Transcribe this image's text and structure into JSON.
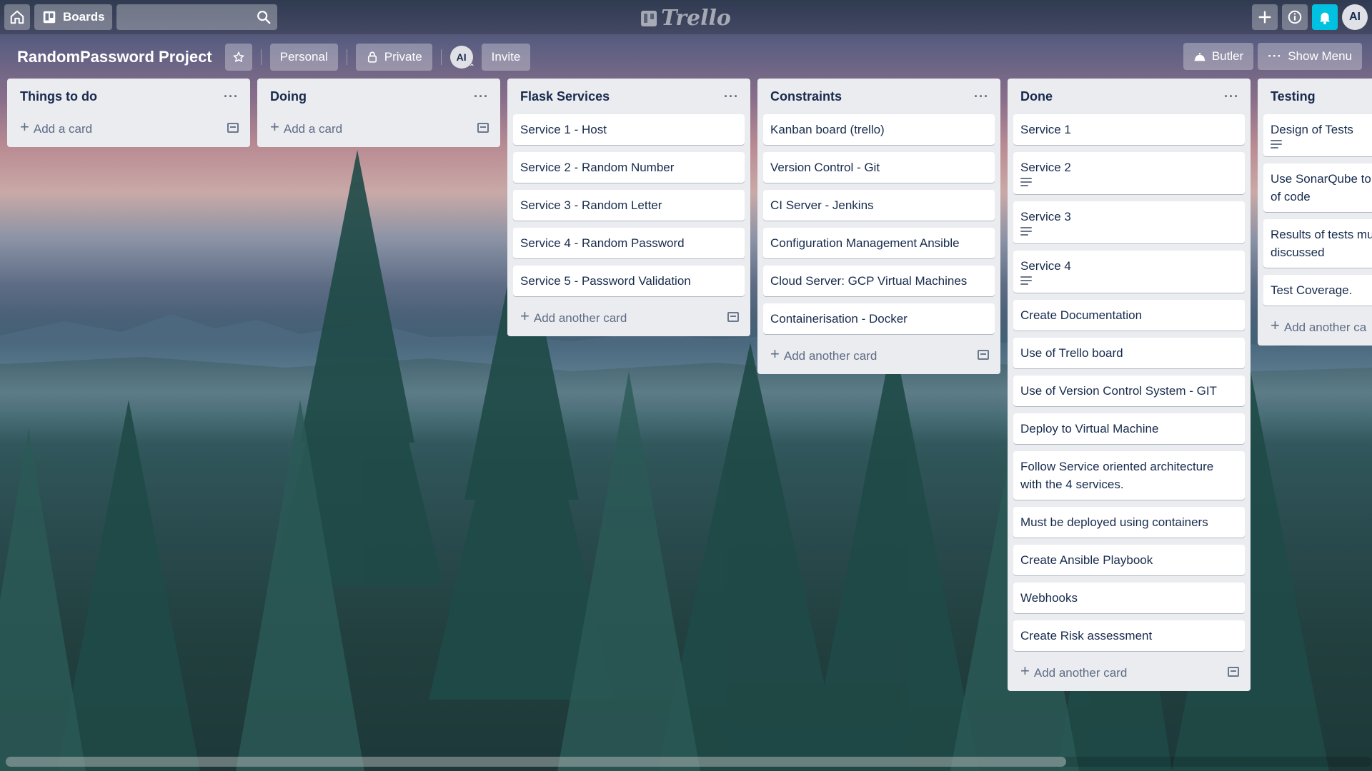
{
  "header": {
    "boards_label": "Boards",
    "search": {
      "placeholder": "",
      "value": ""
    },
    "logo_text": "Trello",
    "avatar_initials": "AI"
  },
  "board": {
    "title": "RandomPassword Project",
    "team_label": "Personal",
    "visibility_label": "Private",
    "member_initials": "AI",
    "invite_label": "Invite",
    "butler_label": "Butler",
    "show_menu_label": "Show Menu"
  },
  "lists": [
    {
      "title": "Things to do",
      "cards": [],
      "add_label": "Add a card"
    },
    {
      "title": "Doing",
      "cards": [],
      "add_label": "Add a card"
    },
    {
      "title": "Flask Services",
      "cards": [
        {
          "text": "Service 1 - Host"
        },
        {
          "text": "Service 2 - Random Number"
        },
        {
          "text": "Service 3 - Random Letter"
        },
        {
          "text": "Service 4 - Random Password"
        },
        {
          "text": "Service 5 - Password Validation"
        }
      ],
      "add_label": "Add another card"
    },
    {
      "title": "Constraints",
      "cards": [
        {
          "text": "Kanban board (trello)"
        },
        {
          "text": "Version Control - Git"
        },
        {
          "text": "CI Server - Jenkins"
        },
        {
          "text": "Configuration Management Ansible"
        },
        {
          "text": "Cloud Server: GCP Virtual Machines"
        },
        {
          "text": "Containerisation - Docker"
        }
      ],
      "add_label": "Add another card"
    },
    {
      "title": "Done",
      "cards": [
        {
          "text": "Service 1"
        },
        {
          "text": "Service 2",
          "has_description": true
        },
        {
          "text": "Service 3",
          "has_description": true
        },
        {
          "text": "Service 4",
          "has_description": true
        },
        {
          "text": "Create Documentation"
        },
        {
          "text": "Use of Trello board"
        },
        {
          "text": "Use of Version Control System - GIT"
        },
        {
          "text": "Deploy to Virtual Machine"
        },
        {
          "text": "Follow Service oriented architecture with the 4 services."
        },
        {
          "text": "Must be deployed using containers"
        },
        {
          "text": "Create Ansible Playbook"
        },
        {
          "text": "Webhooks"
        },
        {
          "text": "Create Risk assessment"
        }
      ],
      "add_label": "Add another card"
    },
    {
      "title": "Testing",
      "cards": [
        {
          "text": "Design of Tests",
          "has_description": true
        },
        {
          "text": "Use SonarQube to of code"
        },
        {
          "text": "Results of tests mu discussed"
        },
        {
          "text": "Test Coverage."
        }
      ],
      "add_label": "Add another ca"
    }
  ],
  "colors": {
    "notification_accent": "#00c2e0",
    "list_background": "#ebecf0",
    "card_text": "#172b4d"
  },
  "icons": [
    "home-icon",
    "boards-icon",
    "search-icon",
    "plus-icon",
    "info-icon",
    "bell-icon",
    "star-icon",
    "lock-icon",
    "butler-icon",
    "more-icon",
    "template-icon",
    "description-icon"
  ]
}
